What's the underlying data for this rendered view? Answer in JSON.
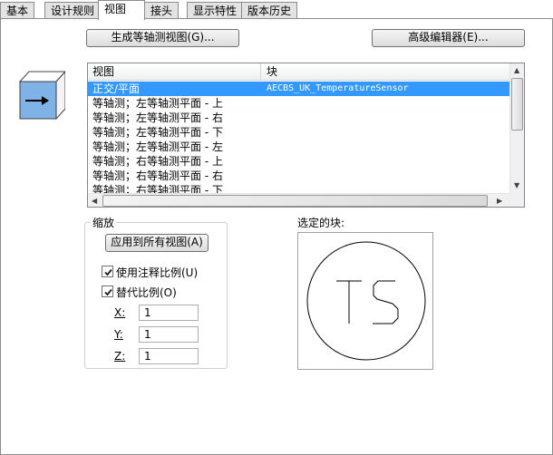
{
  "tabs": [
    {
      "label": "基本"
    },
    {
      "label": "设计规则"
    },
    {
      "label": "视图",
      "active": true
    },
    {
      "label": "接头"
    },
    {
      "label": "显示特性"
    },
    {
      "label": "版本历史"
    }
  ],
  "buttons": {
    "generate": "生成等轴测视图(G)...",
    "advanced": "高级编辑器(E)..."
  },
  "list": {
    "headers": {
      "view": "视图",
      "block": "块"
    },
    "rows": [
      {
        "view": "正交/平面",
        "block": "AECBS_UK_TemperatureSensor",
        "selected": true
      },
      {
        "view": "等轴测；左等轴测平面 - 上",
        "block": ""
      },
      {
        "view": "等轴测；左等轴测平面 - 右",
        "block": ""
      },
      {
        "view": "等轴测；左等轴测平面 - 下",
        "block": ""
      },
      {
        "view": "等轴测；左等轴测平面 - 左",
        "block": ""
      },
      {
        "view": "等轴测；右等轴测平面 - 上",
        "block": ""
      },
      {
        "view": "等轴测；右等轴测平面 - 右",
        "block": ""
      },
      {
        "view": "等轴测；右等轴测平面 - 下",
        "block": ""
      }
    ]
  },
  "scale": {
    "group_title": "缩放",
    "apply_all_button": "应用到所有视图(A)",
    "use_annotation": {
      "label": "使用注释比例(U)",
      "checked": true
    },
    "override": {
      "label": "替代比例(O)",
      "checked": true
    },
    "x": {
      "label": "X:",
      "value": "1"
    },
    "y": {
      "label": "Y:",
      "value": "1"
    },
    "z": {
      "label": "Z:",
      "value": "1"
    }
  },
  "preview": {
    "label": "选定的块:",
    "symbol_text": "TS"
  },
  "colors": {
    "selection": "#3399ff",
    "cube_face": "#7fb2e6"
  }
}
